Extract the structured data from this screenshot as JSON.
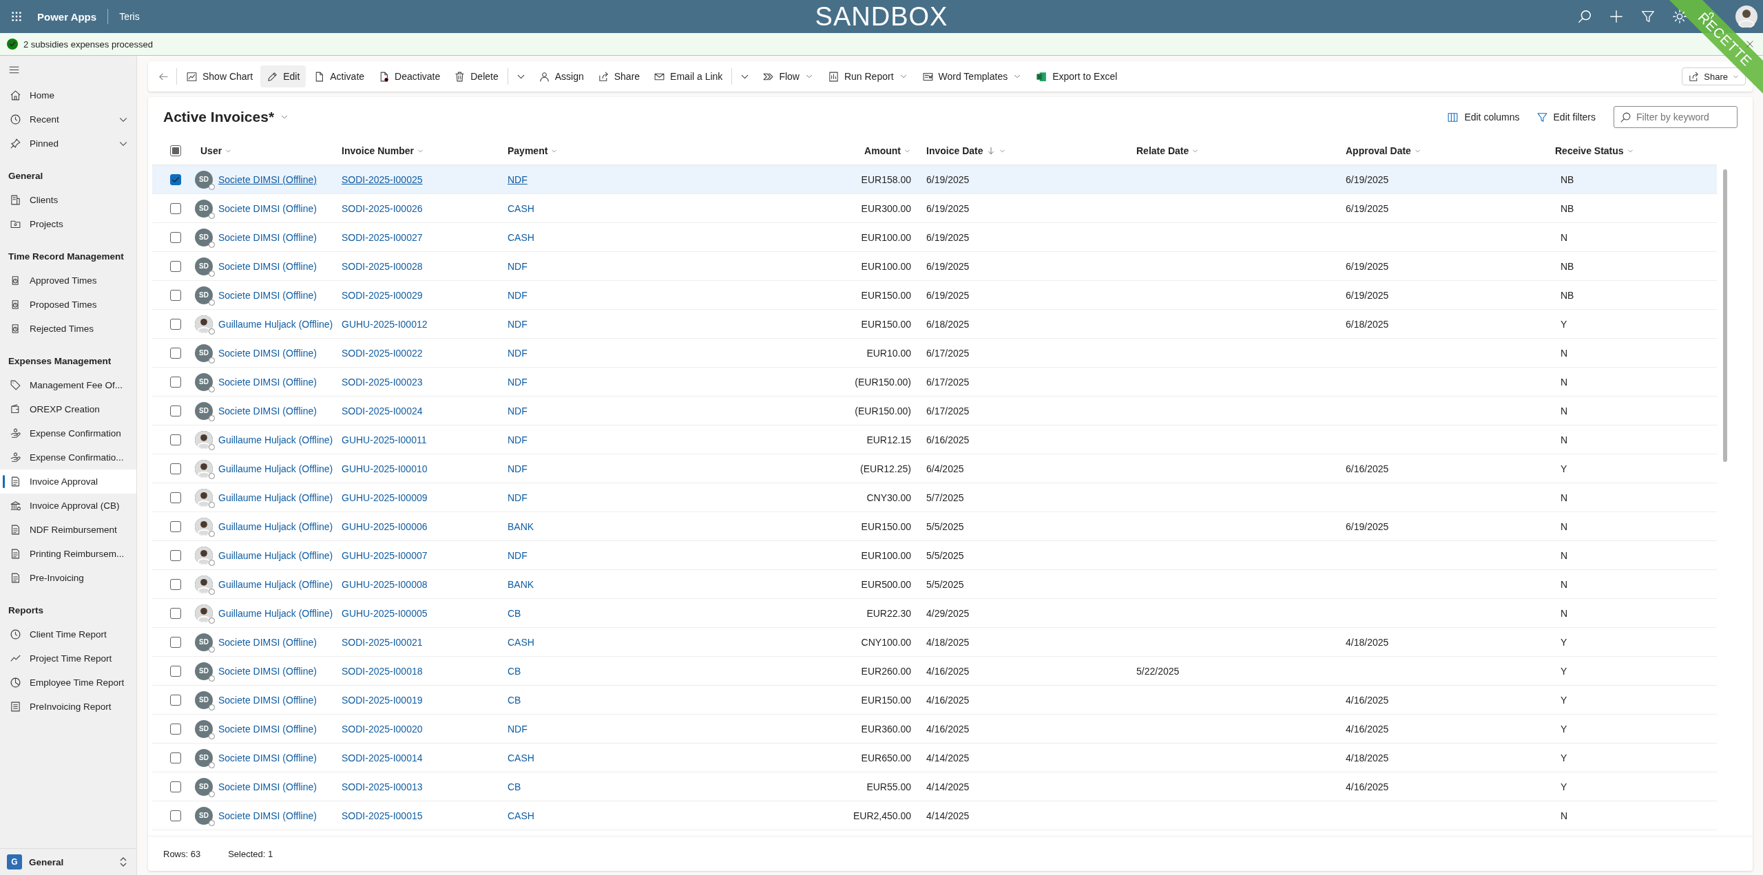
{
  "app_bar": {
    "app_name": "Power Apps",
    "environment": "Teris",
    "banner": "SANDBOX"
  },
  "corner_ribbon": {
    "label": "RECETTE"
  },
  "notification": {
    "message": "2 subsidies expenses processed"
  },
  "sidebar": {
    "sections": [
      {
        "items": [
          {
            "label": "Home",
            "kind": "link",
            "selected": false
          },
          {
            "label": "Recent",
            "kind": "expandable",
            "expanded": false,
            "selected": false
          },
          {
            "label": "Pinned",
            "kind": "expandable",
            "expanded": false,
            "selected": false
          }
        ]
      },
      {
        "heading": "General",
        "items": [
          {
            "label": "Clients",
            "kind": "link",
            "selected": false
          },
          {
            "label": "Projects",
            "kind": "link",
            "selected": false
          }
        ]
      },
      {
        "heading": "Time Record Management",
        "items": [
          {
            "label": "Approved Times",
            "kind": "link",
            "selected": false
          },
          {
            "label": "Proposed Times",
            "kind": "link",
            "selected": false
          },
          {
            "label": "Rejected Times",
            "kind": "link",
            "selected": false
          }
        ]
      },
      {
        "heading": "Expenses Management",
        "items": [
          {
            "label": "Management Fee Of...",
            "kind": "link",
            "selected": false
          },
          {
            "label": "OREXP Creation",
            "kind": "link",
            "selected": false
          },
          {
            "label": "Expense Confirmation",
            "kind": "link",
            "selected": false
          },
          {
            "label": "Expense Confirmatio...",
            "kind": "link",
            "selected": false
          },
          {
            "label": "Invoice Approval",
            "kind": "link",
            "selected": true
          },
          {
            "label": "Invoice Approval (CB)",
            "kind": "link",
            "selected": false
          },
          {
            "label": "NDF Reimbursement",
            "kind": "link",
            "selected": false
          },
          {
            "label": "Printing Reimbursem...",
            "kind": "link",
            "selected": false
          },
          {
            "label": "Pre-Invoicing",
            "kind": "link",
            "selected": false
          }
        ]
      },
      {
        "heading": "Reports",
        "items": [
          {
            "label": "Client Time Report",
            "kind": "link",
            "selected": false
          },
          {
            "label": "Project Time Report",
            "kind": "link",
            "selected": false
          },
          {
            "label": "Employee Time Report",
            "kind": "link",
            "selected": false
          },
          {
            "label": "PreInvoicing Report",
            "kind": "link",
            "selected": false
          }
        ]
      }
    ],
    "area_switcher": {
      "initial": "G",
      "label": "General"
    }
  },
  "command_bar": {
    "items": [
      {
        "kind": "back"
      },
      {
        "kind": "separator"
      },
      {
        "kind": "button",
        "label": "Show Chart",
        "highlighted": false
      },
      {
        "kind": "button",
        "label": "Edit",
        "highlighted": true
      },
      {
        "kind": "button",
        "label": "Activate",
        "highlighted": false
      },
      {
        "kind": "button",
        "label": "Deactivate",
        "highlighted": false
      },
      {
        "kind": "button",
        "label": "Delete",
        "highlighted": false
      },
      {
        "kind": "separator"
      },
      {
        "kind": "more"
      },
      {
        "kind": "button",
        "label": "Assign",
        "highlighted": false
      },
      {
        "kind": "button",
        "label": "Share",
        "highlighted": false
      },
      {
        "kind": "button",
        "label": "Email a Link",
        "highlighted": false
      },
      {
        "kind": "separator"
      },
      {
        "kind": "more"
      },
      {
        "kind": "menu",
        "label": "Flow",
        "highlighted": false
      },
      {
        "kind": "menu",
        "label": "Run Report",
        "highlighted": false
      },
      {
        "kind": "menu",
        "label": "Word Templates",
        "highlighted": false
      },
      {
        "kind": "button",
        "label": "Export to Excel",
        "highlighted": false
      }
    ],
    "share": {
      "label": "Share"
    }
  },
  "grid": {
    "title": "Active Invoices*",
    "tools": [
      {
        "label": "Edit columns"
      },
      {
        "label": "Edit filters"
      }
    ],
    "search": {
      "placeholder": "Filter by keyword"
    },
    "select_all": {
      "indeterminate": true
    },
    "columns": [
      {
        "label": "User",
        "sorted": false
      },
      {
        "label": "Invoice Number",
        "sorted": false
      },
      {
        "label": "Payment",
        "sorted": false
      },
      {
        "label": "Amount",
        "sorted": false
      },
      {
        "label": "Invoice Date",
        "sorted": true
      },
      {
        "label": "Relate Date",
        "sorted": false
      },
      {
        "label": "Approval Date",
        "sorted": false
      },
      {
        "label": "Receive Status",
        "sorted": false
      }
    ],
    "rows": [
      {
        "selected": true,
        "user": {
          "name": "Societe DIMSI (Offline)",
          "avatar": {
            "kind": "initials",
            "initials": "SD"
          }
        },
        "invoice_number": "SODI-2025-I00025",
        "payment": "NDF",
        "amount": "EUR158.00",
        "invoice_date": "6/19/2025",
        "approval_date": "6/19/2025",
        "receive_status": "NB"
      },
      {
        "selected": false,
        "user": {
          "name": "Societe DIMSI (Offline)",
          "avatar": {
            "kind": "initials",
            "initials": "SD"
          }
        },
        "invoice_number": "SODI-2025-I00026",
        "payment": "CASH",
        "amount": "EUR300.00",
        "invoice_date": "6/19/2025",
        "approval_date": "6/19/2025",
        "receive_status": "NB"
      },
      {
        "selected": false,
        "user": {
          "name": "Societe DIMSI (Offline)",
          "avatar": {
            "kind": "initials",
            "initials": "SD"
          }
        },
        "invoice_number": "SODI-2025-I00027",
        "payment": "CASH",
        "amount": "EUR100.00",
        "invoice_date": "6/19/2025",
        "receive_status": "N"
      },
      {
        "selected": false,
        "user": {
          "name": "Societe DIMSI (Offline)",
          "avatar": {
            "kind": "initials",
            "initials": "SD"
          }
        },
        "invoice_number": "SODI-2025-I00028",
        "payment": "NDF",
        "amount": "EUR100.00",
        "invoice_date": "6/19/2025",
        "approval_date": "6/19/2025",
        "receive_status": "NB"
      },
      {
        "selected": false,
        "user": {
          "name": "Societe DIMSI (Offline)",
          "avatar": {
            "kind": "initials",
            "initials": "SD"
          }
        },
        "invoice_number": "SODI-2025-I00029",
        "payment": "NDF",
        "amount": "EUR150.00",
        "invoice_date": "6/19/2025",
        "approval_date": "6/19/2025",
        "receive_status": "NB"
      },
      {
        "selected": false,
        "user": {
          "name": "Guillaume Huljack (Offline)"
        },
        "invoice_number": "GUHU-2025-I00012",
        "payment": "NDF",
        "amount": "EUR150.00",
        "invoice_date": "6/18/2025",
        "approval_date": "6/18/2025",
        "receive_status": "Y"
      },
      {
        "selected": false,
        "user": {
          "name": "Societe DIMSI (Offline)",
          "avatar": {
            "kind": "initials",
            "initials": "SD"
          }
        },
        "invoice_number": "SODI-2025-I00022",
        "payment": "NDF",
        "amount": "EUR10.00",
        "invoice_date": "6/17/2025",
        "receive_status": "N"
      },
      {
        "selected": false,
        "user": {
          "name": "Societe DIMSI (Offline)",
          "avatar": {
            "kind": "initials",
            "initials": "SD"
          }
        },
        "invoice_number": "SODI-2025-I00023",
        "payment": "NDF",
        "amount": "(EUR150.00)",
        "invoice_date": "6/17/2025",
        "receive_status": "N"
      },
      {
        "selected": false,
        "user": {
          "name": "Societe DIMSI (Offline)",
          "avatar": {
            "kind": "initials",
            "initials": "SD"
          }
        },
        "invoice_number": "SODI-2025-I00024",
        "payment": "NDF",
        "amount": "(EUR150.00)",
        "invoice_date": "6/17/2025",
        "receive_status": "N"
      },
      {
        "selected": false,
        "user": {
          "name": "Guillaume Huljack (Offline)"
        },
        "invoice_number": "GUHU-2025-I00011",
        "payment": "NDF",
        "amount": "EUR12.15",
        "invoice_date": "6/16/2025",
        "receive_status": "N"
      },
      {
        "selected": false,
        "user": {
          "name": "Guillaume Huljack (Offline)"
        },
        "invoice_number": "GUHU-2025-I00010",
        "payment": "NDF",
        "amount": "(EUR12.25)",
        "invoice_date": "6/4/2025",
        "approval_date": "6/16/2025",
        "receive_status": "Y"
      },
      {
        "selected": false,
        "user": {
          "name": "Guillaume Huljack (Offline)"
        },
        "invoice_number": "GUHU-2025-I00009",
        "payment": "NDF",
        "amount": "CNY30.00",
        "invoice_date": "5/7/2025",
        "receive_status": "N"
      },
      {
        "selected": false,
        "user": {
          "name": "Guillaume Huljack (Offline)"
        },
        "invoice_number": "GUHU-2025-I00006",
        "payment": "BANK",
        "amount": "EUR150.00",
        "invoice_date": "5/5/2025",
        "approval_date": "6/19/2025",
        "receive_status": "N"
      },
      {
        "selected": false,
        "user": {
          "name": "Guillaume Huljack (Offline)"
        },
        "invoice_number": "GUHU-2025-I00007",
        "payment": "NDF",
        "amount": "EUR100.00",
        "invoice_date": "5/5/2025",
        "receive_status": "N"
      },
      {
        "selected": false,
        "user": {
          "name": "Guillaume Huljack (Offline)"
        },
        "invoice_number": "GUHU-2025-I00008",
        "payment": "BANK",
        "amount": "EUR500.00",
        "invoice_date": "5/5/2025",
        "receive_status": "N"
      },
      {
        "selected": false,
        "user": {
          "name": "Guillaume Huljack (Offline)"
        },
        "invoice_number": "GUHU-2025-I00005",
        "payment": "CB",
        "amount": "EUR22.30",
        "invoice_date": "4/29/2025",
        "receive_status": "N"
      },
      {
        "selected": false,
        "user": {
          "name": "Societe DIMSI (Offline)",
          "avatar": {
            "kind": "initials",
            "initials": "SD"
          }
        },
        "invoice_number": "SODI-2025-I00021",
        "payment": "CASH",
        "amount": "CNY100.00",
        "invoice_date": "4/18/2025",
        "approval_date": "4/18/2025",
        "receive_status": "Y"
      },
      {
        "selected": false,
        "user": {
          "name": "Societe DIMSI (Offline)",
          "avatar": {
            "kind": "initials",
            "initials": "SD"
          }
        },
        "invoice_number": "SODI-2025-I00018",
        "payment": "CB",
        "amount": "EUR260.00",
        "invoice_date": "4/16/2025",
        "relate_date": "5/22/2025",
        "receive_status": "Y"
      },
      {
        "selected": false,
        "user": {
          "name": "Societe DIMSI (Offline)",
          "avatar": {
            "kind": "initials",
            "initials": "SD"
          }
        },
        "invoice_number": "SODI-2025-I00019",
        "payment": "CB",
        "amount": "EUR150.00",
        "invoice_date": "4/16/2025",
        "approval_date": "4/16/2025",
        "receive_status": "Y"
      },
      {
        "selected": false,
        "user": {
          "name": "Societe DIMSI (Offline)",
          "avatar": {
            "kind": "initials",
            "initials": "SD"
          }
        },
        "invoice_number": "SODI-2025-I00020",
        "payment": "NDF",
        "amount": "EUR360.00",
        "invoice_date": "4/16/2025",
        "approval_date": "4/16/2025",
        "receive_status": "Y"
      },
      {
        "selected": false,
        "user": {
          "name": "Societe DIMSI (Offline)",
          "avatar": {
            "kind": "initials",
            "initials": "SD"
          }
        },
        "invoice_number": "SODI-2025-I00014",
        "payment": "CASH",
        "amount": "EUR650.00",
        "invoice_date": "4/14/2025",
        "approval_date": "4/18/2025",
        "receive_status": "Y"
      },
      {
        "selected": false,
        "user": {
          "name": "Societe DIMSI (Offline)",
          "avatar": {
            "kind": "initials",
            "initials": "SD"
          }
        },
        "invoice_number": "SODI-2025-I00013",
        "payment": "CB",
        "amount": "EUR55.00",
        "invoice_date": "4/14/2025",
        "approval_date": "4/16/2025",
        "receive_status": "Y"
      },
      {
        "selected": false,
        "user": {
          "name": "Societe DIMSI (Offline)",
          "avatar": {
            "kind": "initials",
            "initials": "SD"
          }
        },
        "invoice_number": "SODI-2025-I00015",
        "payment": "CASH",
        "amount": "EUR2,450.00",
        "invoice_date": "4/14/2025",
        "receive_status": "N"
      }
    ],
    "footer": {
      "rows": "Rows: 63",
      "selected": "Selected: 1"
    }
  }
}
